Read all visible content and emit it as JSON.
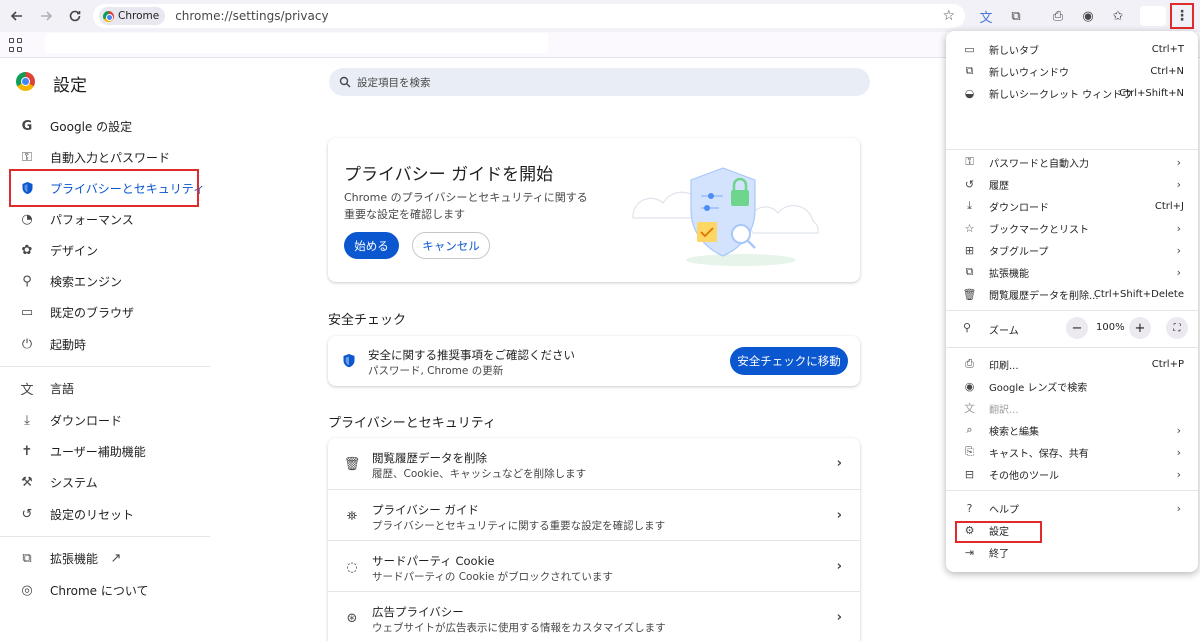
{
  "browser": {
    "chip_label": "Chrome",
    "url": "chrome://settings/privacy"
  },
  "header": {
    "title": "設定",
    "search_placeholder": "設定項目を検索"
  },
  "sidebar": {
    "items": [
      {
        "label": "Google の設定",
        "icon": "google-icon"
      },
      {
        "label": "自動入力とパスワード",
        "icon": "key-icon"
      },
      {
        "label": "プライバシーとセキュリティ",
        "icon": "shield-icon"
      },
      {
        "label": "パフォーマンス",
        "icon": "speedometer-icon"
      },
      {
        "label": "デザイン",
        "icon": "palette-icon"
      },
      {
        "label": "検索エンジン",
        "icon": "search-icon"
      },
      {
        "label": "既定のブラウザ",
        "icon": "browser-icon"
      },
      {
        "label": "起動時",
        "icon": "power-icon"
      },
      {
        "label": "言語",
        "icon": "translate-icon"
      },
      {
        "label": "ダウンロード",
        "icon": "download-icon"
      },
      {
        "label": "ユーザー補助機能",
        "icon": "accessibility-icon"
      },
      {
        "label": "システム",
        "icon": "wrench-icon"
      },
      {
        "label": "設定のリセット",
        "icon": "reset-icon"
      },
      {
        "label": "拡張機能",
        "icon": "puzzle-icon"
      },
      {
        "label": "Chrome について",
        "icon": "chrome-icon"
      }
    ]
  },
  "guide": {
    "title": "プライバシー ガイドを開始",
    "desc": "Chrome のプライバシーとセキュリティに関する重要な設定を確認します",
    "start": "始める",
    "cancel": "キャンセル"
  },
  "safety": {
    "section": "安全チェック",
    "line1": "安全に関する推奨事項をご確認ください",
    "line2": "パスワード, Chrome の更新",
    "button": "安全チェックに移動"
  },
  "privacy": {
    "section": "プライバシーとセキュリティ",
    "rows": [
      {
        "t1": "閲覧履歴データを削除",
        "t2": "履歴、Cookie、キャッシュなどを削除します",
        "icon": "trash-icon"
      },
      {
        "t1": "プライバシー ガイド",
        "t2": "プライバシーとセキュリティに関する重要な設定を確認します",
        "icon": "privacy-guide-icon"
      },
      {
        "t1": "サードパーティ Cookie",
        "t2": "サードパーティの Cookie がブロックされています",
        "icon": "cookie-icon"
      },
      {
        "t1": "広告プライバシー",
        "t2": "ウェブサイトが広告表示に使用する情報をカスタマイズします",
        "icon": "ads-icon"
      }
    ]
  },
  "menu": {
    "items": [
      {
        "label": "新しいタブ",
        "shortcut": "Ctrl+T",
        "icon": "new-tab-icon"
      },
      {
        "label": "新しいウィンドウ",
        "shortcut": "Ctrl+N",
        "icon": "new-window-icon"
      },
      {
        "label": "新しいシークレット ウィンドウ",
        "shortcut": "Ctrl+Shift+N",
        "icon": "incognito-icon"
      },
      {
        "label": "パスワードと自動入力",
        "icon": "key-icon"
      },
      {
        "label": "履歴",
        "icon": "history-icon"
      },
      {
        "label": "ダウンロード",
        "shortcut": "Ctrl+J",
        "icon": "download-icon"
      },
      {
        "label": "ブックマークとリスト",
        "icon": "star-icon"
      },
      {
        "label": "タブグループ",
        "icon": "tab-groups-icon"
      },
      {
        "label": "拡張機能",
        "icon": "puzzle-icon"
      },
      {
        "label": "閲覧履歴データを削除...",
        "shortcut": "Ctrl+Shift+Delete",
        "icon": "trash-icon"
      },
      {
        "label": "印刷...",
        "shortcut": "Ctrl+P",
        "icon": "print-icon"
      },
      {
        "label": "Google レンズで検索",
        "icon": "lens-icon"
      },
      {
        "label": "翻訳...",
        "icon": "translate-icon"
      },
      {
        "label": "検索と編集",
        "icon": "find-icon"
      },
      {
        "label": "キャスト、保存、共有",
        "icon": "cast-icon"
      },
      {
        "label": "その他のツール",
        "icon": "toolbox-icon"
      },
      {
        "label": "ヘルプ",
        "icon": "help-icon"
      },
      {
        "label": "設定",
        "icon": "gear-icon"
      },
      {
        "label": "終了",
        "icon": "exit-icon"
      }
    ],
    "zoom_label": "ズーム",
    "zoom_value": "100%",
    "zoom_minus": "−",
    "zoom_plus": "+"
  },
  "colors": {
    "accent": "#0b57d0",
    "highlight_box": "#e02b2b"
  }
}
